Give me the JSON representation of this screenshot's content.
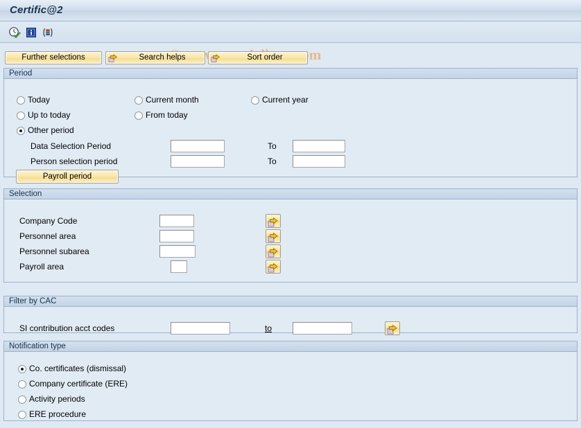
{
  "window": {
    "title": "Certific@2"
  },
  "watermark": {
    "text": "© www.tutorialkart.com"
  },
  "toolbar": {
    "icons": [
      {
        "name": "execute-icon",
        "title": "Execute (F8)"
      },
      {
        "name": "info-icon",
        "title": "Information"
      },
      {
        "name": "variant-icon",
        "title": "Get Variant"
      }
    ]
  },
  "actionbar": {
    "further_selections": "Further selections",
    "search_helps": "Search helps",
    "sort_order": "Sort order"
  },
  "period": {
    "header": "Period",
    "options": [
      {
        "label": "Today",
        "selected": false
      },
      {
        "label": "Current month",
        "selected": false
      },
      {
        "label": "Current year",
        "selected": false
      },
      {
        "label": "Up to today",
        "selected": false
      },
      {
        "label": "From today",
        "selected": false
      },
      {
        "label": "Other period",
        "selected": true
      }
    ],
    "rows": [
      {
        "label": "Data Selection Period",
        "from_value": "",
        "to_label": "To",
        "to_value": ""
      },
      {
        "label": "Person selection period",
        "from_value": "",
        "to_label": "To",
        "to_value": ""
      }
    ],
    "payroll_period_button": "Payroll period"
  },
  "selection": {
    "header": "Selection",
    "rows": [
      {
        "label": "Company Code",
        "value": ""
      },
      {
        "label": "Personnel area",
        "value": ""
      },
      {
        "label": "Personnel subarea",
        "value": ""
      },
      {
        "label": "Payroll area",
        "value": ""
      }
    ]
  },
  "filter_cac": {
    "header": "Filter by CAC",
    "row": {
      "label": "SI contribution acct codes",
      "from_value": "",
      "to_label": "to",
      "to_value": ""
    }
  },
  "notification": {
    "header": "Notification type",
    "options": [
      {
        "label": "Co. certificates (dismissal)",
        "selected": true
      },
      {
        "label": "Company certificate (ERE)",
        "selected": false
      },
      {
        "label": "Activity periods",
        "selected": false
      },
      {
        "label": "ERE procedure",
        "selected": false
      }
    ]
  },
  "colors": {
    "title_text": "#19324d",
    "panel_bg": "#e1ebf4",
    "panel_border": "#9ab3cb",
    "gold_button": "#f9e6a4",
    "watermark": "#e9b581"
  }
}
